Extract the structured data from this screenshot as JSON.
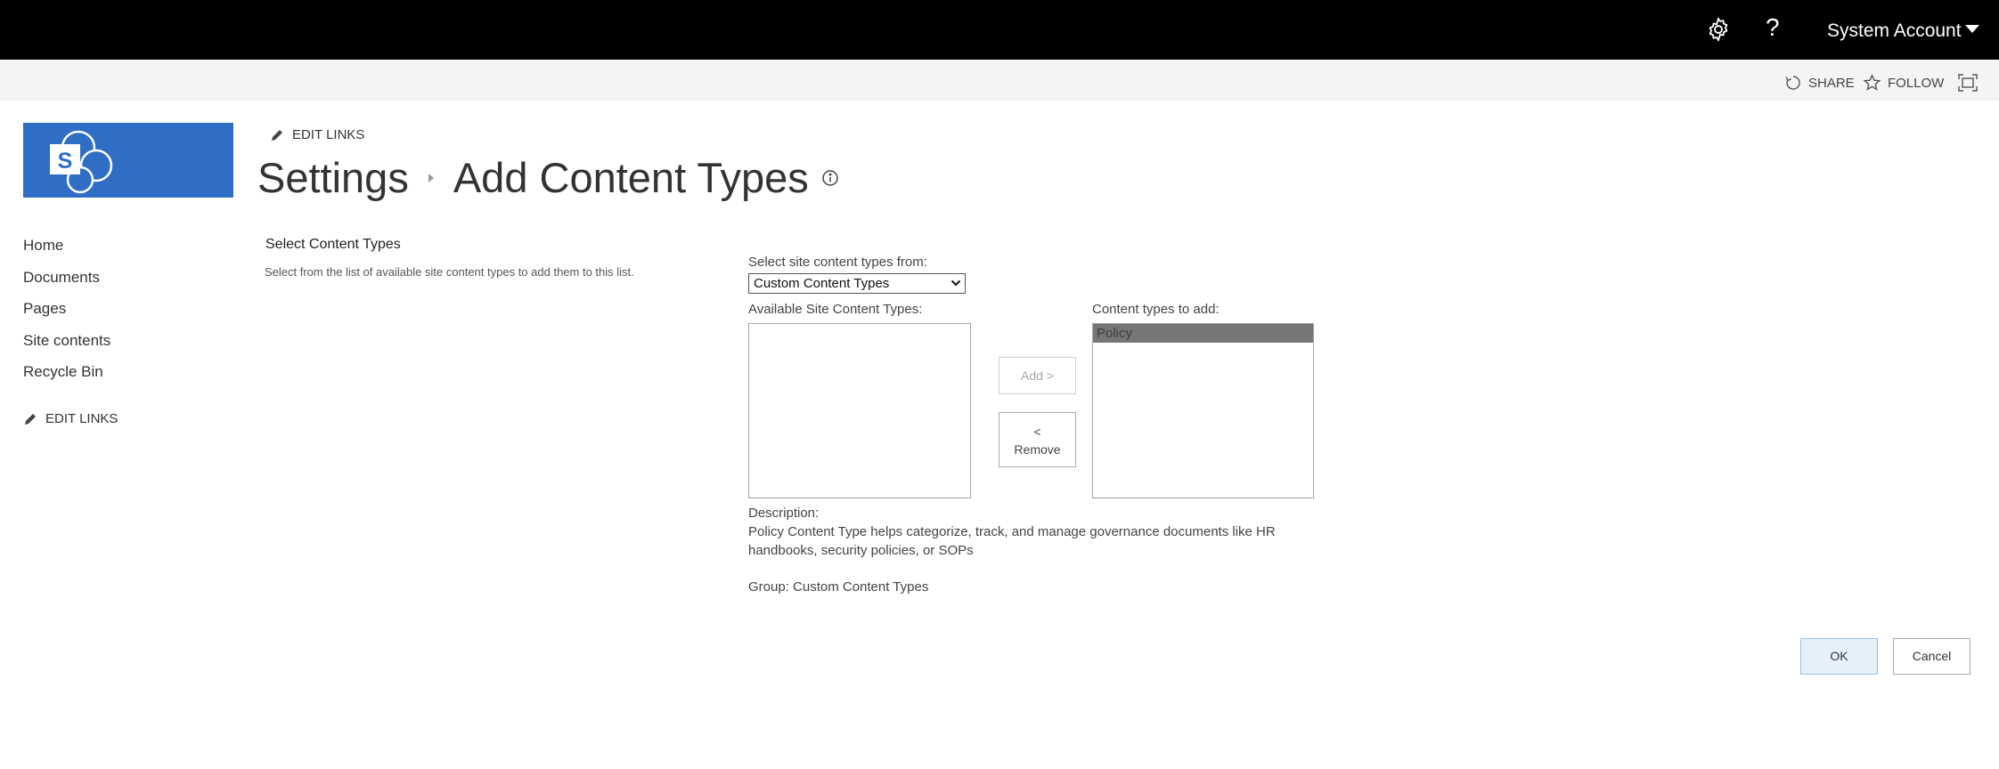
{
  "suitebar": {
    "help_label": "?",
    "account_name": "System Account"
  },
  "actionbar": {
    "share_label": "SHARE",
    "follow_label": "FOLLOW"
  },
  "logo": {
    "letter": "S",
    "color": "#2f6ec4"
  },
  "leftnav": {
    "items": [
      {
        "label": "Home"
      },
      {
        "label": "Documents"
      },
      {
        "label": "Pages"
      },
      {
        "label": "Site contents"
      },
      {
        "label": "Recycle Bin"
      }
    ],
    "edit_links_label": "EDIT LINKS"
  },
  "header": {
    "edit_links_label": "EDIT LINKS",
    "breadcrumb_parent": "Settings",
    "breadcrumb_current": "Add Content Types"
  },
  "section": {
    "title": "Select Content Types",
    "description": "Select from the list of available site content types to add them to this list."
  },
  "form": {
    "source_label": "Select site content types from:",
    "source_selected": "Custom Content Types",
    "available_label": "Available Site Content Types:",
    "available_items": [],
    "to_add_label": "Content types to add:",
    "to_add_items": [
      {
        "label": "Policy",
        "selected": true
      }
    ],
    "add_button": "Add >",
    "remove_button_line1": "<",
    "remove_button_line2": "Remove",
    "description_label": "Description:",
    "description_text": "Policy Content Type helps categorize, track, and manage governance documents like HR handbooks, security policies, or SOPs",
    "group_text": "Group: Custom Content Types"
  },
  "footer": {
    "ok_button": "OK",
    "cancel_button": "Cancel"
  },
  "colors": {
    "suitebar_bg": "#000000",
    "actionbar_bg": "#f4f4f4",
    "selected_item_bg": "#767676",
    "ok_button_bg": "#e6f0fa"
  }
}
